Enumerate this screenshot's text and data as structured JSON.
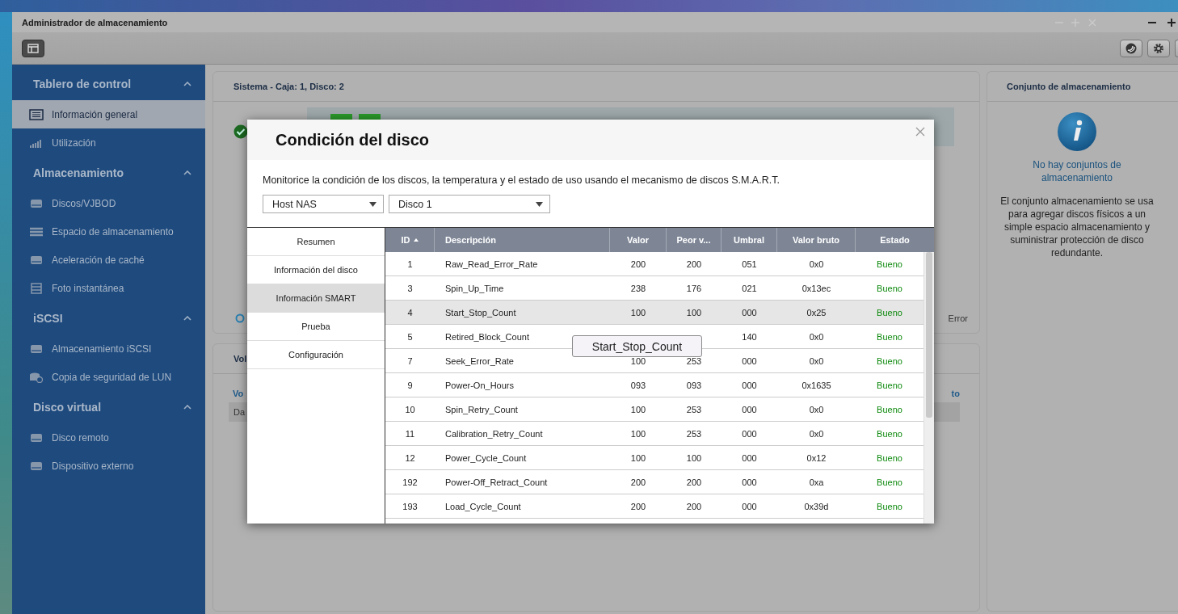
{
  "window": {
    "title": "Administrador de almacenamiento"
  },
  "sidebar": {
    "groups": [
      {
        "title": "Tablero de control",
        "expanded": true,
        "items": [
          {
            "label": "Información general",
            "selected": true
          },
          {
            "label": "Utilización",
            "selected": false
          }
        ]
      },
      {
        "title": "Almacenamiento",
        "expanded": true,
        "items": [
          {
            "label": "Discos/VJBOD",
            "selected": false
          },
          {
            "label": "Espacio de almacenamiento",
            "selected": false
          },
          {
            "label": "Aceleración de caché",
            "selected": false
          },
          {
            "label": "Foto instantánea",
            "selected": false
          }
        ]
      },
      {
        "title": "iSCSI",
        "expanded": true,
        "items": [
          {
            "label": "Almacenamiento iSCSI",
            "selected": false
          },
          {
            "label": "Copia de seguridad de LUN",
            "selected": false
          }
        ]
      },
      {
        "title": "Disco virtual",
        "expanded": true,
        "items": [
          {
            "label": "Disco remoto",
            "selected": false
          },
          {
            "label": "Dispositivo externo",
            "selected": false
          }
        ]
      }
    ]
  },
  "system_panel": {
    "title": "Sistema - Caja: 1, Disco: 2",
    "legend_error": "Error"
  },
  "volume_panel": {
    "title": "Vol",
    "column_1": "Vo",
    "column_2": "to",
    "row_1": "Da"
  },
  "storage_pool_panel": {
    "title": "Conjunto de almacenamiento",
    "empty_title": "No hay conjuntos de almacenamiento",
    "empty_text": "El conjunto almacenamiento se usa para agregar discos físicos a un simple espacio almacenamiento y suministrar protección de disco redundante."
  },
  "dialog": {
    "title": "Condición del disco",
    "description": "Monitorice la condición de los discos, la temperatura y el estado de uso usando el mecanismo de discos S.M.A.R.T.",
    "selects": [
      {
        "value": "Host NAS"
      },
      {
        "value": "Disco 1"
      }
    ],
    "tabs": [
      {
        "label": "Resumen",
        "selected": false
      },
      {
        "label": "Información del disco",
        "selected": false
      },
      {
        "label": "Información SMART",
        "selected": true
      },
      {
        "label": "Prueba",
        "selected": false
      },
      {
        "label": "Configuración",
        "selected": false
      }
    ],
    "columns": [
      {
        "label": "ID",
        "sorted": true
      },
      {
        "label": "Descripción",
        "sorted": false
      },
      {
        "label": "Valor",
        "sorted": false
      },
      {
        "label": "Peor v...",
        "sorted": false
      },
      {
        "label": "Umbral",
        "sorted": false
      },
      {
        "label": "Valor bruto",
        "sorted": false
      },
      {
        "label": "Estado",
        "sorted": false
      }
    ],
    "rows": [
      {
        "id": "1",
        "description": "Raw_Read_Error_Rate",
        "value": "200",
        "worst": "200",
        "threshold": "051",
        "raw": "0x0",
        "status": "Bueno",
        "selected": false
      },
      {
        "id": "3",
        "description": "Spin_Up_Time",
        "value": "238",
        "worst": "176",
        "threshold": "021",
        "raw": "0x13ec",
        "status": "Bueno",
        "selected": false
      },
      {
        "id": "4",
        "description": "Start_Stop_Count",
        "value": "100",
        "worst": "100",
        "threshold": "000",
        "raw": "0x25",
        "status": "Bueno",
        "selected": true
      },
      {
        "id": "5",
        "description": "Retired_Block_Count",
        "threshold": "140",
        "raw": "0x0",
        "status": "Bueno",
        "selected": false
      },
      {
        "id": "7",
        "description": "Seek_Error_Rate",
        "value": "100",
        "worst": "253",
        "threshold": "000",
        "raw": "0x0",
        "status": "Bueno",
        "selected": false
      },
      {
        "id": "9",
        "description": "Power-On_Hours",
        "value": "093",
        "worst": "093",
        "threshold": "000",
        "raw": "0x1635",
        "status": "Bueno",
        "selected": false
      },
      {
        "id": "10",
        "description": "Spin_Retry_Count",
        "value": "100",
        "worst": "253",
        "threshold": "000",
        "raw": "0x0",
        "status": "Bueno",
        "selected": false
      },
      {
        "id": "11",
        "description": "Calibration_Retry_Count",
        "value": "100",
        "worst": "253",
        "threshold": "000",
        "raw": "0x0",
        "status": "Bueno",
        "selected": false
      },
      {
        "id": "12",
        "description": "Power_Cycle_Count",
        "value": "100",
        "worst": "100",
        "threshold": "000",
        "raw": "0x12",
        "status": "Bueno",
        "selected": false
      },
      {
        "id": "192",
        "description": "Power-Off_Retract_Count",
        "value": "200",
        "worst": "200",
        "threshold": "000",
        "raw": "0xa",
        "status": "Bueno",
        "selected": false
      },
      {
        "id": "193",
        "description": "Load_Cycle_Count",
        "value": "200",
        "worst": "200",
        "threshold": "000",
        "raw": "0x39d",
        "status": "Bueno",
        "selected": false
      }
    ],
    "tooltip": "Start_Stop_Count"
  }
}
